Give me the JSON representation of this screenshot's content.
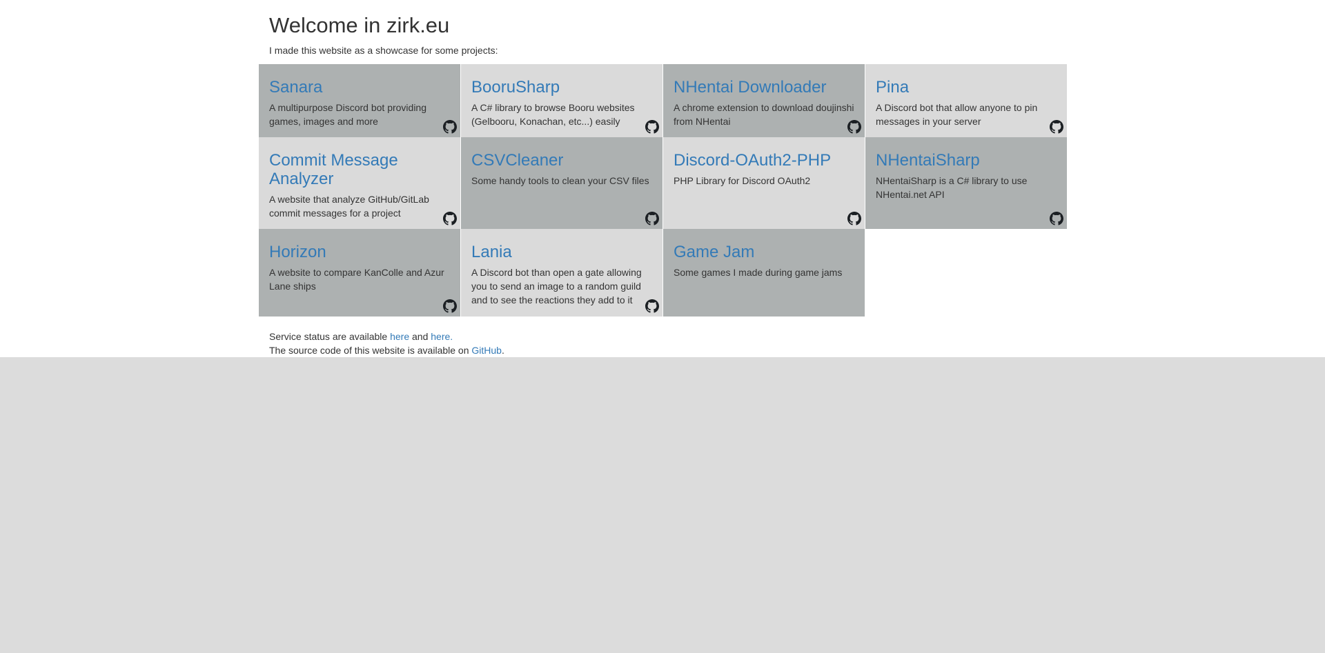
{
  "header": {
    "title": "Welcome in zirk.eu",
    "intro": "I made this website as a showcase for some projects:"
  },
  "projects": [
    {
      "name": "Sanara",
      "description": "A multipurpose Discord bot providing games, images and more",
      "shade": "dark",
      "github": true
    },
    {
      "name": "BooruSharp",
      "description": "A C# library to browse Booru websites (Gelbooru, Konachan, etc...) easily",
      "shade": "light",
      "github": true
    },
    {
      "name": "NHentai Downloader",
      "description": "A chrome extension to download doujinshi from NHentai",
      "shade": "dark",
      "github": true
    },
    {
      "name": "Pina",
      "description": "A Discord bot that allow anyone to pin messages in your server",
      "shade": "light",
      "github": true
    },
    {
      "name": "Commit Message Analyzer",
      "description": "A website that analyze GitHub/GitLab commit messages for a project",
      "shade": "light",
      "github": true
    },
    {
      "name": "CSVCleaner",
      "description": "Some handy tools to clean your CSV files",
      "shade": "dark",
      "github": true
    },
    {
      "name": "Discord-OAuth2-PHP",
      "description": "PHP Library for Discord OAuth2",
      "shade": "light",
      "github": true
    },
    {
      "name": "NHentaiSharp",
      "description": "NHentaiSharp is a C# library to use NHentai.net API",
      "shade": "dark",
      "github": true
    },
    {
      "name": "Horizon",
      "description": "A website to compare KanColle and Azur Lane ships",
      "shade": "dark",
      "github": true
    },
    {
      "name": "Lania",
      "description": "A Discord bot than open a gate allowing you to send an image to a random guild and to see the reactions they add to it",
      "shade": "light",
      "github": true
    },
    {
      "name": "Game Jam",
      "description": "Some games I made during game jams",
      "shade": "dark",
      "github": false
    }
  ],
  "footer": {
    "status_prefix": "Service status are available ",
    "status_link1": "here",
    "status_mid": " and ",
    "status_link2": "here.",
    "source_prefix": "The source code of this website is available on ",
    "source_link": "GitHub",
    "source_suffix": "."
  },
  "colors": {
    "link": "#337ab7",
    "tile_dark": "#adb1b1",
    "tile_light": "#dadada",
    "page_bottom": "#dcdcdc"
  },
  "icons": {
    "repo_link": "github-icon"
  }
}
